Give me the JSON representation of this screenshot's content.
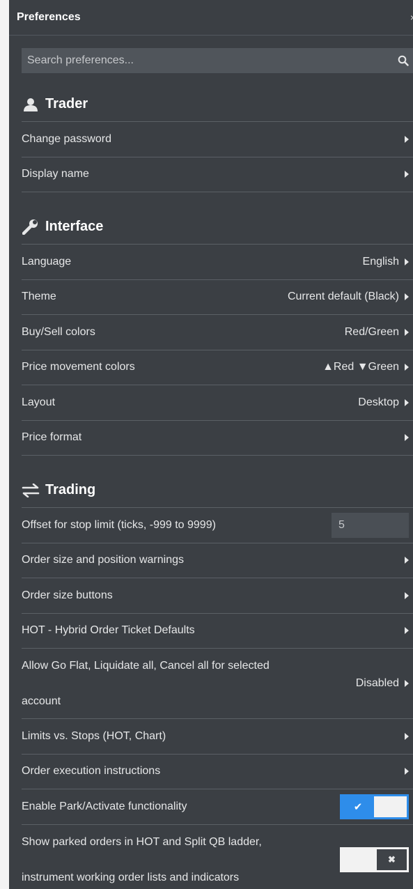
{
  "window": {
    "title": "Preferences",
    "close_glyph": "×"
  },
  "search": {
    "placeholder": "Search preferences...",
    "icon": "search-icon"
  },
  "sections": {
    "trader": {
      "heading": "Trader",
      "icon": "user-icon",
      "rows": [
        "Change password",
        "Display name"
      ]
    },
    "interface": {
      "heading": "Interface",
      "icon": "wrench-icon",
      "rows": [
        {
          "label": "Language",
          "value": "English"
        },
        {
          "label": "Theme",
          "value": "Current default (Black)"
        },
        {
          "label": "Buy/Sell colors",
          "value": "Red/Green"
        },
        {
          "label": "Price movement colors",
          "value": "▲Red ▼Green"
        },
        {
          "label": "Layout",
          "value": "Desktop"
        },
        {
          "label": "Price format",
          "value": ""
        }
      ]
    },
    "trading": {
      "heading": "Trading",
      "icon": "exchange-arrows-icon",
      "offset": {
        "label": "Offset for stop limit (ticks, -999 to 9999)",
        "value": "5"
      },
      "rows": [
        "Order size and position warnings",
        "Order size buttons",
        "HOT - Hybrid Order Ticket Defaults"
      ],
      "allow_flat": {
        "label_line1": "Allow Go Flat, Liquidate all, Cancel all for selected",
        "label_line2": "account",
        "value": "Disabled"
      },
      "rows2": [
        "Limits vs. Stops (HOT, Chart)",
        "Order execution instructions"
      ],
      "park": {
        "label": "Enable Park/Activate functionality",
        "state": "on",
        "mark": "✔"
      },
      "show_parked": {
        "label_line1": "Show parked orders in HOT and Split QB ladder,",
        "label_line2": "instrument working order lists and indicators",
        "state": "off",
        "mark": "✖"
      }
    }
  },
  "colors": {
    "panel": "#3b3f44",
    "toggle_on": "#2e8dea",
    "divider": "#5b6066"
  }
}
